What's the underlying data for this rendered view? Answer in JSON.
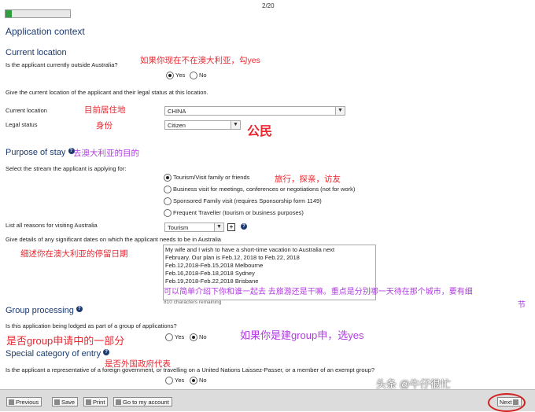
{
  "progress": {
    "page": "2/20",
    "fraction": 0.1
  },
  "page_title": "Application context",
  "current_location_section": {
    "title": "Current location",
    "q_outside": "Is the applicant currently outside Australia?",
    "options": [
      "Yes",
      "No"
    ],
    "selected": "Yes",
    "note": "Give the current location of the applicant and their legal status at this location.",
    "location_label": "Current location",
    "location_value": "CHINA",
    "legal_status_label": "Legal status",
    "legal_status_value": "Citizen"
  },
  "purpose_section": {
    "title": "Purpose of stay",
    "stream_question": "Select the stream the applicant is applying for:",
    "streams": [
      "Tourism/Visit family or friends",
      "Business visit for meetings, conferences or negotiations (not for work)",
      "Sponsored Family visit (requires Sponsorship form 1149)",
      "Frequent Traveller (tourism or business purposes)"
    ],
    "selected_stream": "Tourism/Visit family or friends",
    "reasons_label": "List all reasons for visiting Australia",
    "reason_value": "Tourism",
    "dates_label": "Give details of any significant dates on which the applicant needs to be in Australia",
    "dates_text": [
      "My wife and I wish to have a short-time vacation to Australia next",
      "February. Our plan is Feb.12, 2018 to Feb.22, 2018",
      "Feb.12,2018-Feb.15,2018 Melbourne",
      "Feb.16,2018-Feb.18,2018 Sydney",
      "Feb.19,2018-Feb.22,2018 Brisbane"
    ],
    "chars_remaining": "810 characters remaining"
  },
  "group_section": {
    "title": "Group processing",
    "question": "Is this application being lodged as part of a group of applications?",
    "options": [
      "Yes",
      "No"
    ],
    "selected": "No"
  },
  "special_section": {
    "title": "Special category of entry",
    "question": "Is the applicant a representative of a foreign government, or travelling on a United Nations Laissez-Passer, or a member of an exempt group?",
    "options": [
      "Yes",
      "No"
    ],
    "selected": "No"
  },
  "footer": {
    "previous": "Previous",
    "save": "Save",
    "print": "Print",
    "account": "Go to my account",
    "next": "Next"
  },
  "annotations": {
    "a1": "如果你现在不在澳大利亚，勾yes",
    "a2": "目前居住地",
    "a3": "身份",
    "a4": "公民",
    "a5": "去澳大利亚的目的",
    "a6": "旅行，探亲，访友",
    "a7": "细述你在澳大利亚的停留日期",
    "a8": "可以简单介绍下你和谁一起去 去旅游还是干嘛。重点是分别哪一天待在那个城市，要有细",
    "a8b": "节",
    "a9": "是否group申请中的一部分",
    "a10": "如果你是建group申，选yes",
    "a11": "是否外国政府代表"
  },
  "watermark": "头条 @牛仔很忙"
}
